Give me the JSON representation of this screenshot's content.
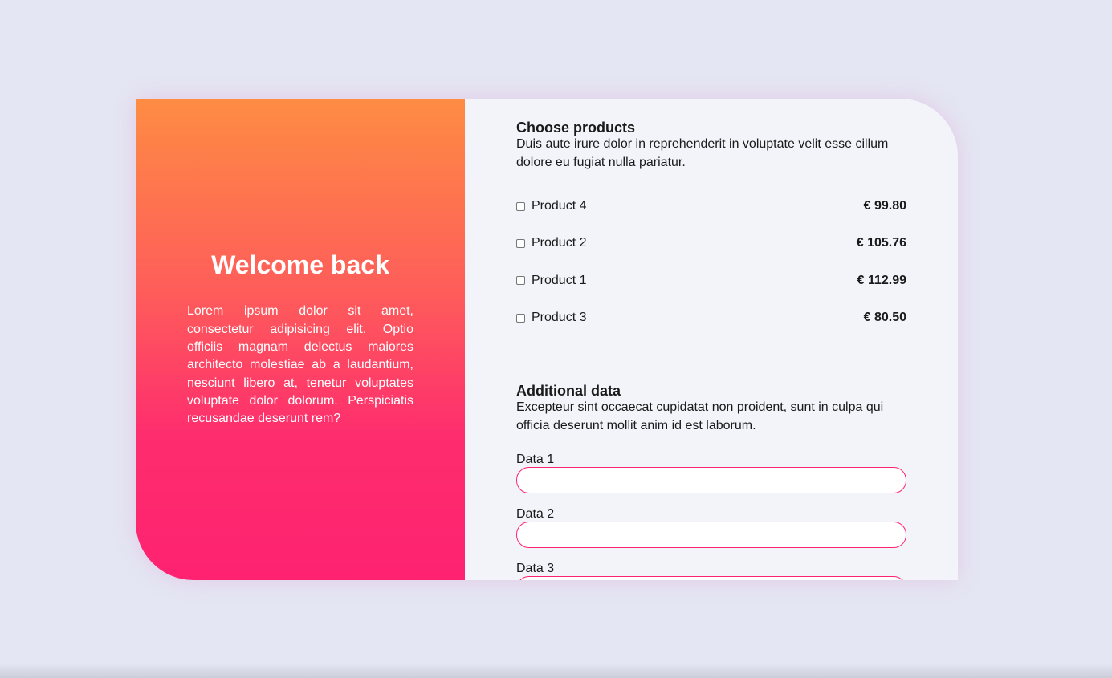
{
  "welcome": {
    "title": "Welcome back",
    "text": "Lorem ipsum dolor sit amet, consectetur adipisicing elit. Optio officiis magnam delectus maiores architecto molestiae ab a laudantium, nesciunt libero at, tenetur voluptates voluptate dolor dolorum. Perspiciatis recusandae deserunt rem?"
  },
  "products": {
    "title": "Choose products",
    "description": "Duis aute irure dolor in reprehenderit in voluptate velit esse cillum dolore eu fugiat nulla pariatur.",
    "items": [
      {
        "name": "Product 4",
        "price": "€ 99.80"
      },
      {
        "name": "Product 2",
        "price": "€ 105.76"
      },
      {
        "name": "Product 1",
        "price": "€ 112.99"
      },
      {
        "name": "Product 3",
        "price": "€ 80.50"
      }
    ]
  },
  "additional": {
    "title": "Additional data",
    "description": "Excepteur sint occaecat cupidatat non proident, sunt in culpa qui officia deserunt mollit anim id est laborum.",
    "fields": [
      {
        "label": "Data 1",
        "value": ""
      },
      {
        "label": "Data 2",
        "value": ""
      },
      {
        "label": "Data 3",
        "value": ""
      }
    ]
  },
  "colors": {
    "background": "#e4e6f3",
    "gradient_top": "#fe8c43",
    "gradient_bottom": "#fe2270",
    "accent": "#fe2270",
    "panel": "#f3f4fa"
  }
}
